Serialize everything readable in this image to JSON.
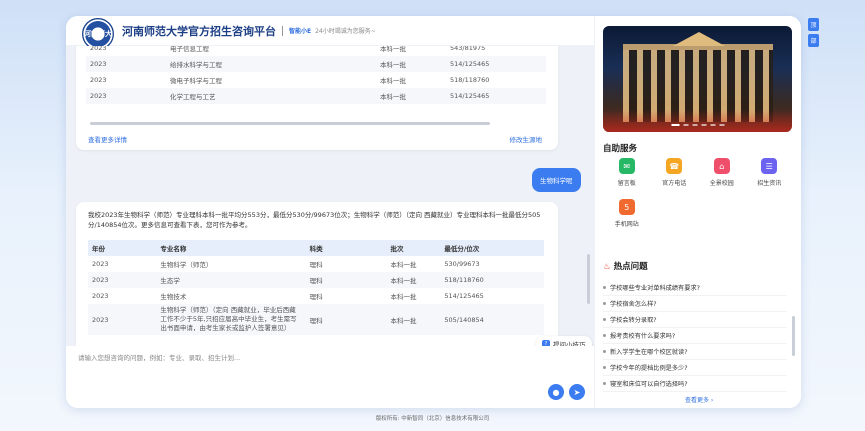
{
  "header": {
    "logo_text": "河南师大",
    "brand": "河南师范大学官方招生咨询平台",
    "assistant_name": "智能小E",
    "assistant_tagline": "24小时竭诚为您服务~"
  },
  "chat": {
    "card1": {
      "rows": [
        [
          "2023",
          "电子信息工程",
          "",
          "本科一批",
          "543/81975"
        ],
        [
          "2023",
          "给排水科学与工程",
          "",
          "本科一批",
          "514/125465"
        ],
        [
          "2023",
          "微电子科学与工程",
          "",
          "本科一批",
          "518/118760"
        ],
        [
          "2023",
          "化学工程与工艺",
          "",
          "本科一批",
          "514/125465"
        ]
      ],
      "view_more": "查看更多详情",
      "edit_link": "修改生源地"
    },
    "user_message": "生物科学呢",
    "answer": {
      "text": "我校2023年生物科学（师范）专业理科本科一批平均分553分，最低分530分/99673位次；生物科学（师范）（定向 西藏就业）专业理科本科一批最低分505分/140854位次。更多信息可查看下表，您可作为参考。",
      "columns": [
        "年份",
        "专业名称",
        "科类",
        "批次",
        "最低分/位次"
      ],
      "rows": [
        [
          "2023",
          "生物科学（师范）",
          "理科",
          "本科一批",
          "530/99673"
        ],
        [
          "2023",
          "生态学",
          "理科",
          "本科一批",
          "518/118760"
        ],
        [
          "2023",
          "生物技术",
          "理科",
          "本科一批",
          "514/125465"
        ],
        [
          "2023",
          "生物科学（师范）（定向 西藏就业，毕业后西藏工作不少于5年,只招应届高中毕业生，考生需写出书面申请，由考生家长或监护人签署意见）",
          "理科",
          "本科一批",
          "505/140854"
        ]
      ]
    },
    "tips_button": "提问小技巧",
    "input_placeholder": "请输入您想咨询的问题，例如：专业、录取、招生计划..."
  },
  "sidebar": {
    "service_title": "自助服务",
    "services": [
      {
        "label": "留言板",
        "icon": "message-board-icon",
        "color": "#27b865",
        "glyph": "✉"
      },
      {
        "label": "官方电话",
        "icon": "phone-icon",
        "color": "#f5a623",
        "glyph": "☎"
      },
      {
        "label": "全景校园",
        "icon": "campus-icon",
        "color": "#ef4f6b",
        "glyph": "⌂"
      },
      {
        "label": "招生资讯",
        "icon": "news-icon",
        "color": "#6c63f0",
        "glyph": "☰"
      },
      {
        "label": "手机网站",
        "icon": "html5-icon",
        "color": "#f06a2f",
        "glyph": "5"
      }
    ],
    "hot_title": "热点问题",
    "hot_questions": [
      "学校哪些专业对单科成绩有要求?",
      "学校宿舍怎么样?",
      "学校会转分录取?",
      "报考贵校有什么要求吗?",
      "新入学学生在哪个校区就读?",
      "学校今年的提档比例是多少?",
      "寝室和床位可以自行选择吗?"
    ],
    "view_more": "查看更多 ›"
  },
  "float_buttons": [
    "顶",
    "部"
  ],
  "footer": {
    "copyright": "版权所有: 中新智同（北京）信息技术有限公司"
  }
}
